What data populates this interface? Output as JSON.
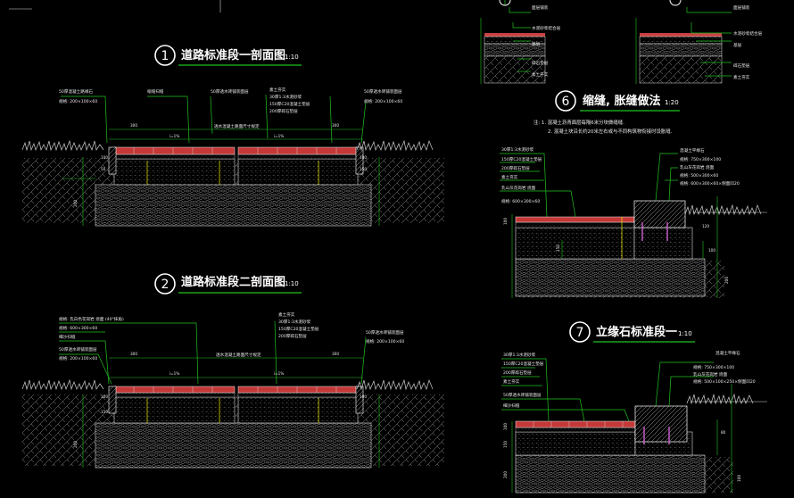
{
  "sections": [
    {
      "num": "1",
      "title": "道路标准段一剖面图",
      "scale": "1:10"
    },
    {
      "num": "2",
      "title": "道路标准段二剖面图",
      "scale": "1:10"
    },
    {
      "num": "6",
      "title": "缩缝, 胀缝做法",
      "scale": "1:20"
    },
    {
      "num": "7",
      "title": "立缘石标准段一",
      "scale": "1:10"
    }
  ],
  "sec1_labels": {
    "l1": "50厚混凝土路缘石",
    "l2": "规格: 200×100×60",
    "l3": "缩缝扫缝",
    "l4": "50厚透水砖铺装面层",
    "r1": "素土夯实",
    "r2": "30厚1:3水泥砂浆",
    "r3": "150厚C20混凝土垫层",
    "r4": "200厚碎石垫层",
    "r5": "50厚透水砖铺装面层",
    "r6": "规格: 200×100×60",
    "mid": "透水混凝土路面尺寸规定"
  },
  "sec1_dims": [
    "300",
    "i=1%",
    "i=1%",
    "300",
    "100",
    "100",
    "50",
    "150",
    "200"
  ],
  "sec2_labels": {
    "l1": "规格: 乳白色花岗岩 烧面 (40°抹角)",
    "l2": "规格: 600×300×60",
    "l3": "细沙扫缝",
    "l4": "50厚透水砖铺装面层",
    "l5": "规格: 200×100×60",
    "r1": "素土夯实",
    "r2": "30厚1:3水泥砂浆",
    "r3": "150厚C20混凝土垫层",
    "r4": "200厚碎石垫层",
    "r5": "50厚透水砖铺装面层",
    "r6": "规格: 200×100×60",
    "mid": "透水混凝土路面尺寸规定"
  },
  "sec2_dims": [
    "300",
    "i=1%",
    "i=1%",
    "300",
    "100",
    "100",
    "150",
    "200"
  ],
  "top_labels": [
    "面层铺装",
    "水泥砂浆结合层",
    "基层",
    "碎石垫层",
    "素土夯实",
    "面层铺装",
    "水泥砂浆结合层",
    "基层",
    "碎石垫层",
    "素土夯实"
  ],
  "sec6_notes": [
    "注: 1. 混凝土沥青面层每隔6米分块做缝缝.",
    "2. 混凝土块沿长约20米左右或与不同构筑物衔接时设胀缝."
  ],
  "sec6_labels": {
    "l1": "30厚1:3水泥砂浆",
    "l2": "150厚C20混凝土垫层",
    "l3": "200厚碎石垫层",
    "l4": "素土夯实",
    "l5": "乳山灰花岗岩 烧面",
    "l6": "规格: 600×300×60",
    "r1": "混凝土平缘石",
    "r2": "规格: 750×300×100",
    "r3": "乳山灰花岗岩 烧面",
    "r4": "规格: 500×300×60",
    "r5": "规格: 600×300×60×侧面凹20"
  },
  "sec6_dims": [
    "100",
    "150",
    "200",
    "120",
    "100"
  ],
  "sec7_labels": {
    "l1": "30厚1:3水泥砂浆",
    "l2": "150厚C20混凝土垫层",
    "l3": "200厚碎石垫层",
    "l4": "素土夯实",
    "l5": "50厚透水砖铺装面层",
    "l6": "细沙扫缝",
    "r1": "混凝土平缘石",
    "r2": "规格: 750×300×100",
    "r3": "乳山灰花岗岩 烧面",
    "r4": "规格: 500×100×250×侧面凹20"
  },
  "sec7_dims": [
    "100",
    "150",
    "200",
    "80",
    "100"
  ]
}
